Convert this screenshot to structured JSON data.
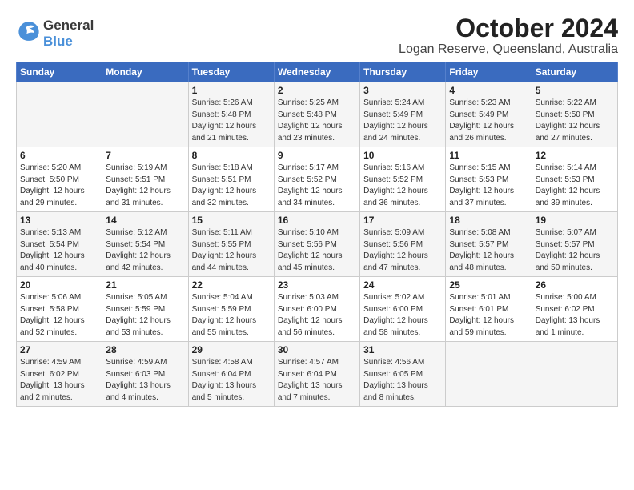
{
  "header": {
    "logo_line1": "General",
    "logo_line2": "Blue",
    "title": "October 2024",
    "subtitle": "Logan Reserve, Queensland, Australia"
  },
  "weekdays": [
    "Sunday",
    "Monday",
    "Tuesday",
    "Wednesday",
    "Thursday",
    "Friday",
    "Saturday"
  ],
  "weeks": [
    [
      {
        "day": "",
        "info": ""
      },
      {
        "day": "",
        "info": ""
      },
      {
        "day": "1",
        "info": "Sunrise: 5:26 AM\nSunset: 5:48 PM\nDaylight: 12 hours and 21 minutes."
      },
      {
        "day": "2",
        "info": "Sunrise: 5:25 AM\nSunset: 5:48 PM\nDaylight: 12 hours and 23 minutes."
      },
      {
        "day": "3",
        "info": "Sunrise: 5:24 AM\nSunset: 5:49 PM\nDaylight: 12 hours and 24 minutes."
      },
      {
        "day": "4",
        "info": "Sunrise: 5:23 AM\nSunset: 5:49 PM\nDaylight: 12 hours and 26 minutes."
      },
      {
        "day": "5",
        "info": "Sunrise: 5:22 AM\nSunset: 5:50 PM\nDaylight: 12 hours and 27 minutes."
      }
    ],
    [
      {
        "day": "6",
        "info": "Sunrise: 5:20 AM\nSunset: 5:50 PM\nDaylight: 12 hours and 29 minutes."
      },
      {
        "day": "7",
        "info": "Sunrise: 5:19 AM\nSunset: 5:51 PM\nDaylight: 12 hours and 31 minutes."
      },
      {
        "day": "8",
        "info": "Sunrise: 5:18 AM\nSunset: 5:51 PM\nDaylight: 12 hours and 32 minutes."
      },
      {
        "day": "9",
        "info": "Sunrise: 5:17 AM\nSunset: 5:52 PM\nDaylight: 12 hours and 34 minutes."
      },
      {
        "day": "10",
        "info": "Sunrise: 5:16 AM\nSunset: 5:52 PM\nDaylight: 12 hours and 36 minutes."
      },
      {
        "day": "11",
        "info": "Sunrise: 5:15 AM\nSunset: 5:53 PM\nDaylight: 12 hours and 37 minutes."
      },
      {
        "day": "12",
        "info": "Sunrise: 5:14 AM\nSunset: 5:53 PM\nDaylight: 12 hours and 39 minutes."
      }
    ],
    [
      {
        "day": "13",
        "info": "Sunrise: 5:13 AM\nSunset: 5:54 PM\nDaylight: 12 hours and 40 minutes."
      },
      {
        "day": "14",
        "info": "Sunrise: 5:12 AM\nSunset: 5:54 PM\nDaylight: 12 hours and 42 minutes."
      },
      {
        "day": "15",
        "info": "Sunrise: 5:11 AM\nSunset: 5:55 PM\nDaylight: 12 hours and 44 minutes."
      },
      {
        "day": "16",
        "info": "Sunrise: 5:10 AM\nSunset: 5:56 PM\nDaylight: 12 hours and 45 minutes."
      },
      {
        "day": "17",
        "info": "Sunrise: 5:09 AM\nSunset: 5:56 PM\nDaylight: 12 hours and 47 minutes."
      },
      {
        "day": "18",
        "info": "Sunrise: 5:08 AM\nSunset: 5:57 PM\nDaylight: 12 hours and 48 minutes."
      },
      {
        "day": "19",
        "info": "Sunrise: 5:07 AM\nSunset: 5:57 PM\nDaylight: 12 hours and 50 minutes."
      }
    ],
    [
      {
        "day": "20",
        "info": "Sunrise: 5:06 AM\nSunset: 5:58 PM\nDaylight: 12 hours and 52 minutes."
      },
      {
        "day": "21",
        "info": "Sunrise: 5:05 AM\nSunset: 5:59 PM\nDaylight: 12 hours and 53 minutes."
      },
      {
        "day": "22",
        "info": "Sunrise: 5:04 AM\nSunset: 5:59 PM\nDaylight: 12 hours and 55 minutes."
      },
      {
        "day": "23",
        "info": "Sunrise: 5:03 AM\nSunset: 6:00 PM\nDaylight: 12 hours and 56 minutes."
      },
      {
        "day": "24",
        "info": "Sunrise: 5:02 AM\nSunset: 6:00 PM\nDaylight: 12 hours and 58 minutes."
      },
      {
        "day": "25",
        "info": "Sunrise: 5:01 AM\nSunset: 6:01 PM\nDaylight: 12 hours and 59 minutes."
      },
      {
        "day": "26",
        "info": "Sunrise: 5:00 AM\nSunset: 6:02 PM\nDaylight: 13 hours and 1 minute."
      }
    ],
    [
      {
        "day": "27",
        "info": "Sunrise: 4:59 AM\nSunset: 6:02 PM\nDaylight: 13 hours and 2 minutes."
      },
      {
        "day": "28",
        "info": "Sunrise: 4:59 AM\nSunset: 6:03 PM\nDaylight: 13 hours and 4 minutes."
      },
      {
        "day": "29",
        "info": "Sunrise: 4:58 AM\nSunset: 6:04 PM\nDaylight: 13 hours and 5 minutes."
      },
      {
        "day": "30",
        "info": "Sunrise: 4:57 AM\nSunset: 6:04 PM\nDaylight: 13 hours and 7 minutes."
      },
      {
        "day": "31",
        "info": "Sunrise: 4:56 AM\nSunset: 6:05 PM\nDaylight: 13 hours and 8 minutes."
      },
      {
        "day": "",
        "info": ""
      },
      {
        "day": "",
        "info": ""
      }
    ]
  ]
}
